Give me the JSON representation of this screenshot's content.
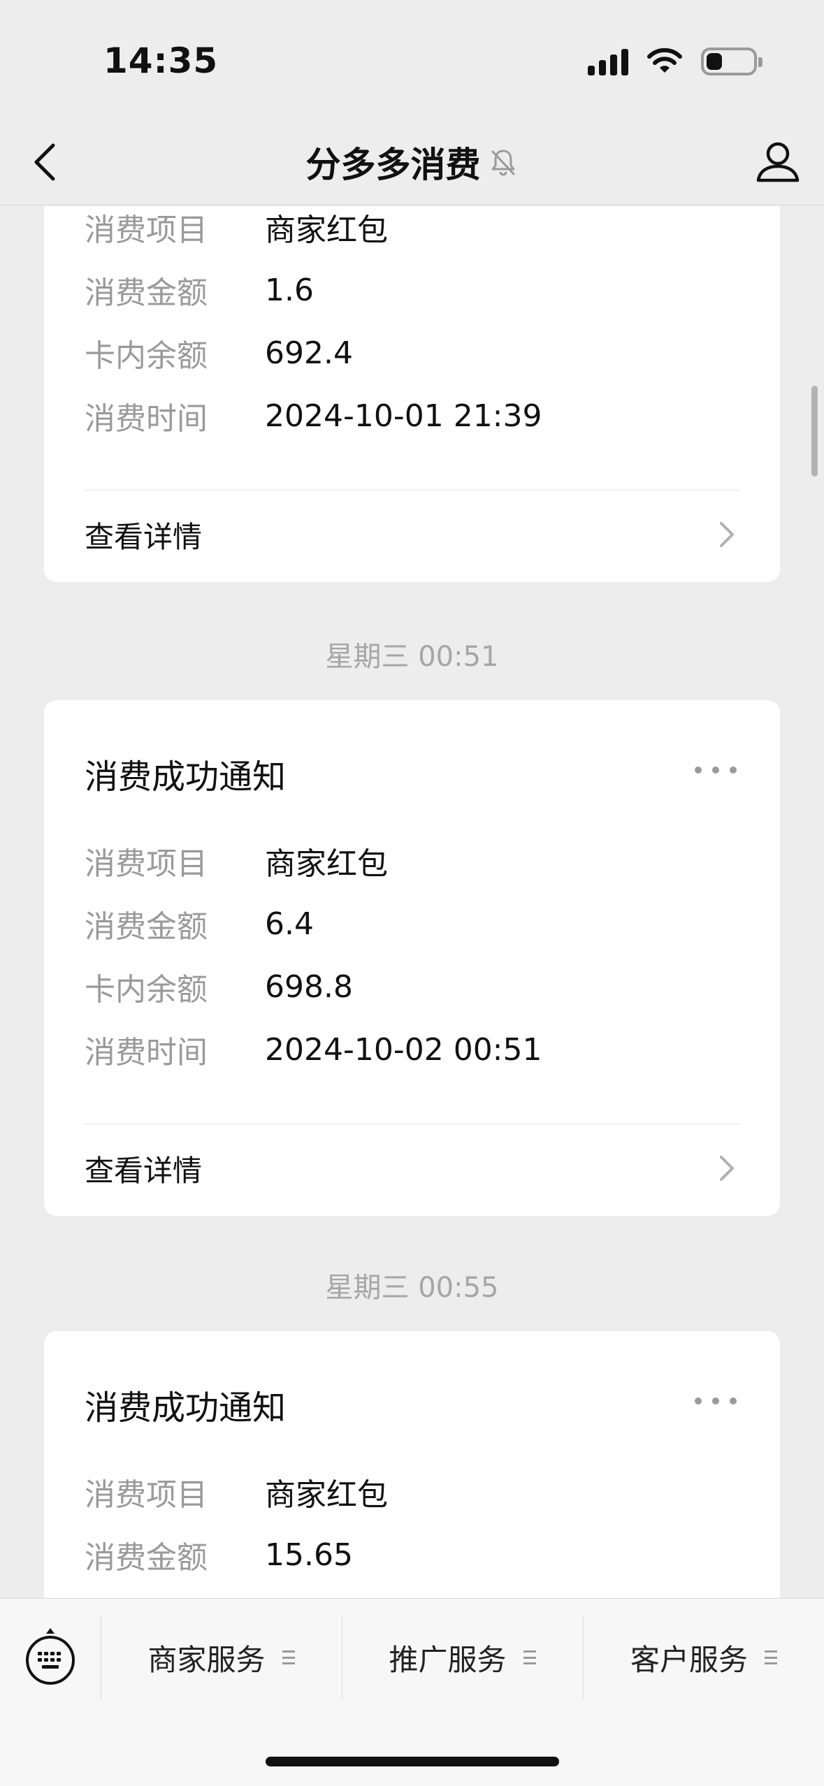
{
  "status_bar": {
    "time": "14:35",
    "battery_level": 0.35,
    "icons": [
      "cellular-signal-icon",
      "wifi-icon",
      "battery-icon"
    ]
  },
  "nav": {
    "title": "分多多消费",
    "icons": [
      "back-icon",
      "mute-bell-icon",
      "profile-icon"
    ]
  },
  "messages": [
    {
      "timestamp": "",
      "title": "",
      "fields": [
        {
          "label": "消费项目",
          "value": "商家红包"
        },
        {
          "label": "消费金额",
          "value": "1.6"
        },
        {
          "label": "卡内余额",
          "value": "692.4"
        },
        {
          "label": "消费时间",
          "value": "2024-10-01 21:39"
        }
      ],
      "details_label": "查看详情"
    },
    {
      "timestamp": "星期三 00:51",
      "title": "消费成功通知",
      "fields": [
        {
          "label": "消费项目",
          "value": "商家红包"
        },
        {
          "label": "消费金额",
          "value": "6.4"
        },
        {
          "label": "卡内余额",
          "value": "698.8"
        },
        {
          "label": "消费时间",
          "value": "2024-10-02 00:51"
        }
      ],
      "details_label": "查看详情"
    },
    {
      "timestamp": "星期三 00:55",
      "title": "消费成功通知",
      "fields": [
        {
          "label": "消费项目",
          "value": "商家红包"
        },
        {
          "label": "消费金额",
          "value": "15.65"
        }
      ]
    }
  ],
  "menu": {
    "items": [
      {
        "label": "商家服务"
      },
      {
        "label": "推广服务"
      },
      {
        "label": "客户服务"
      }
    ],
    "icons": [
      "keyboard-icon",
      "menu-lines-icon"
    ]
  }
}
